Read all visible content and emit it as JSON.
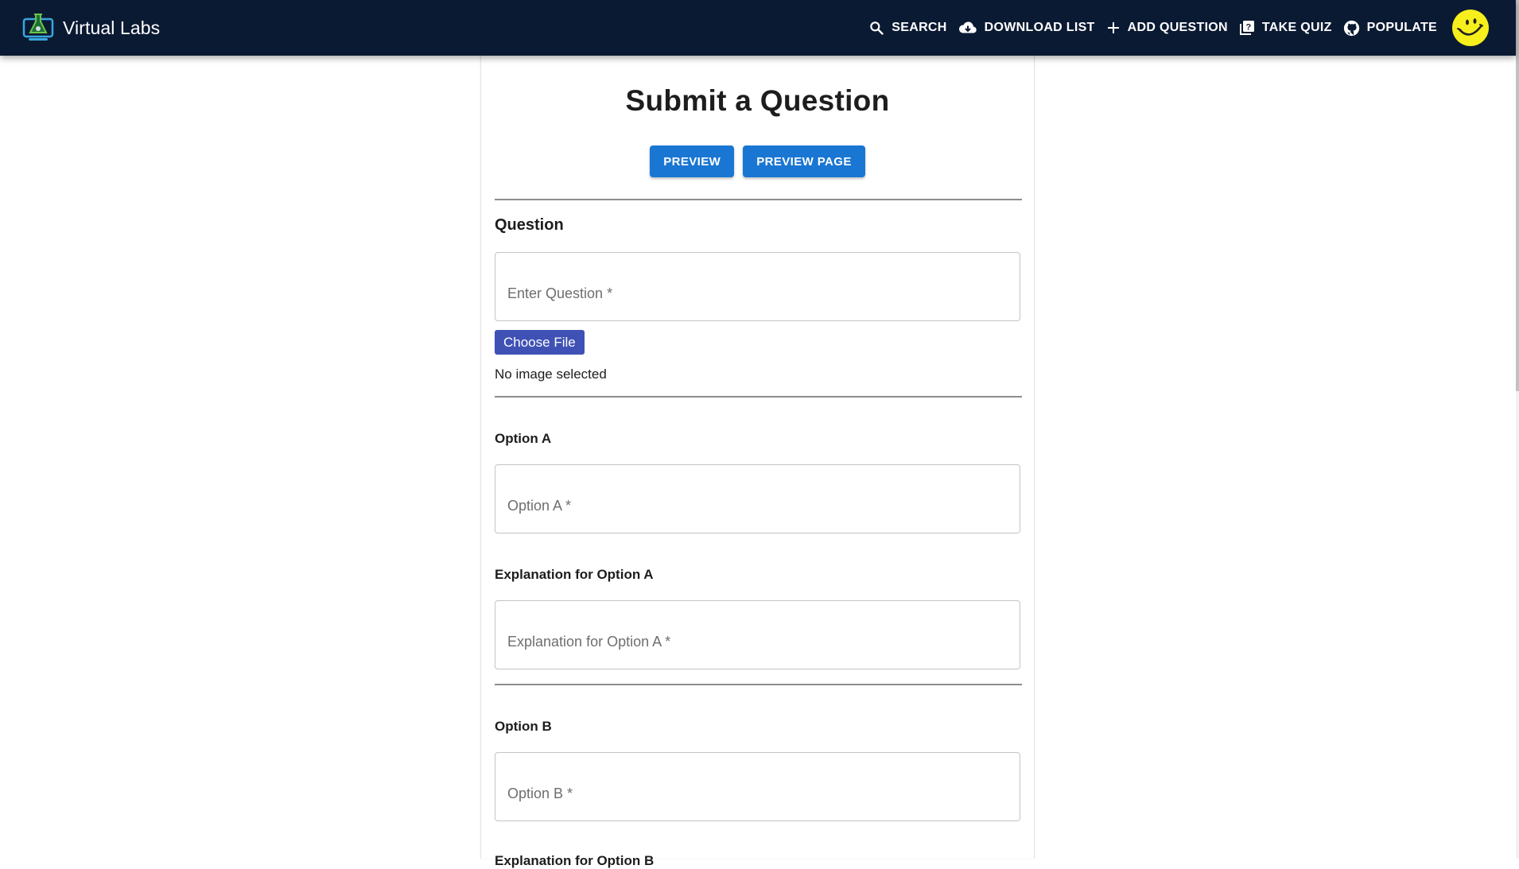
{
  "app": {
    "title": "Virtual Labs",
    "logo_icon": "flask-monitor-icon"
  },
  "nav": {
    "items": [
      {
        "label": "SEARCH",
        "icon": "search-icon"
      },
      {
        "label": "DOWNLOAD LIST",
        "icon": "cloud-download-icon"
      },
      {
        "label": "ADD QUESTION",
        "icon": "plus-icon"
      },
      {
        "label": "TAKE QUIZ",
        "icon": "quiz-icon"
      },
      {
        "label": "POPULATE",
        "icon": "github-icon"
      }
    ],
    "avatar_icon": "smiley-avatar-icon"
  },
  "form": {
    "title": "Submit a Question",
    "preview_label": "PREVIEW",
    "preview_page_label": "PREVIEW PAGE",
    "question_heading": "Question",
    "question_placeholder": "Enter Question *",
    "question_value": "",
    "choose_file_label": "Choose File",
    "file_status": "No image selected",
    "option_a_heading": "Option A",
    "option_a_placeholder": "Option A *",
    "option_a_value": "",
    "explanation_a_heading": "Explanation for Option A",
    "explanation_a_placeholder": "Explanation for Option A *",
    "explanation_a_value": "",
    "option_b_heading": "Option B",
    "option_b_placeholder": "Option B *",
    "option_b_value": "",
    "explanation_b_heading": "Explanation for Option B"
  },
  "colors": {
    "appbar": "#0b1a33",
    "primary_button": "#1976d2",
    "file_button": "#3f51b5",
    "avatar": "#f7ef1c"
  }
}
